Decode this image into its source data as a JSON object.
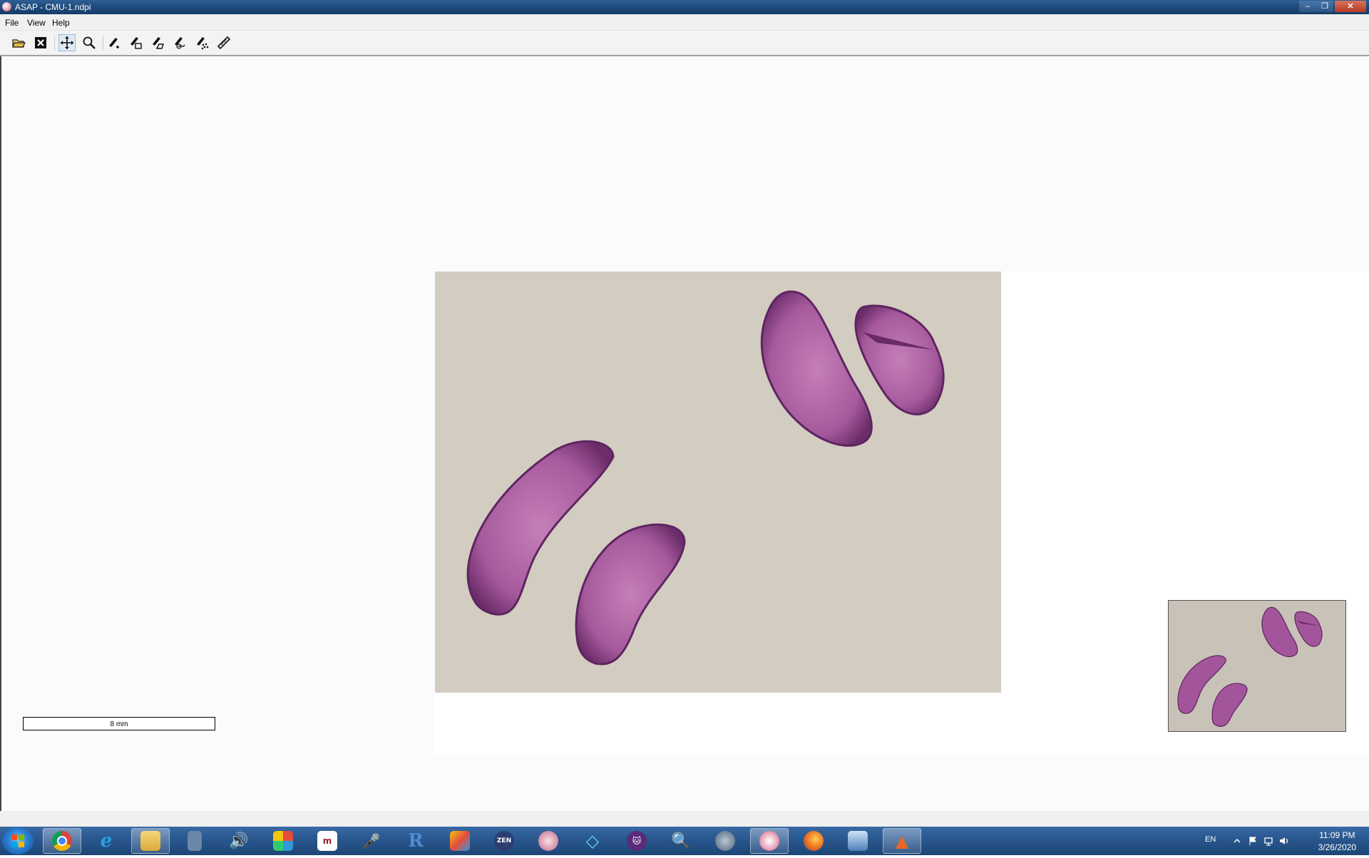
{
  "window": {
    "title": "ASAP - CMU-1.ndpi",
    "minimize_glyph": "–",
    "maximize_glyph": "❐",
    "close_glyph": "✕"
  },
  "menu": {
    "file": "File",
    "view": "View",
    "help": "Help"
  },
  "toolbar": {
    "tools": [
      {
        "icon": "open-folder-icon"
      },
      {
        "icon": "close-file-icon"
      },
      {
        "icon": "pan-icon",
        "active": true
      },
      {
        "icon": "zoom-icon"
      },
      {
        "icon": "dot-annotation-icon"
      },
      {
        "icon": "rectangle-annotation-icon"
      },
      {
        "icon": "polygon-annotation-icon"
      },
      {
        "icon": "spline-annotation-icon"
      },
      {
        "icon": "point-set-annotation-icon"
      },
      {
        "icon": "ruler-icon"
      }
    ]
  },
  "viewer": {
    "scale_bar_label": "8 mm",
    "slide_background": "#d3ccc1",
    "tissue_color": "#a2559a"
  },
  "taskbar": {
    "apps": [
      "chrome-icon",
      "internet-explorer-icon",
      "file-explorer-icon",
      "calculator-icon",
      "speaker-icon",
      "app-cubes-icon",
      "mendeley-icon",
      "microphone-icon",
      "r-icon",
      "paint-icon",
      "zen-icon",
      "balloon-icon",
      "diamond-icon",
      "cat-icon",
      "magnifier-icon",
      "globe-search-icon",
      "asap-icon",
      "firefox-icon",
      "network-icon",
      "matlab-icon"
    ],
    "zen_label": "ZEN",
    "r_label": "R",
    "language": "EN",
    "time": "11:09 PM",
    "date": "3/26/2020"
  }
}
